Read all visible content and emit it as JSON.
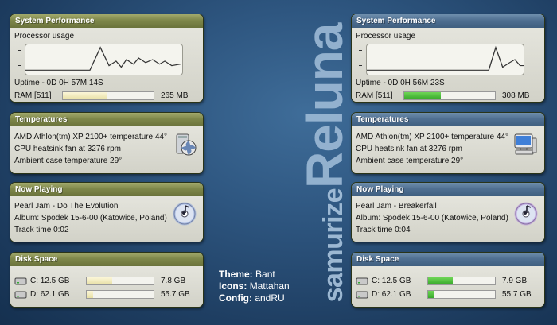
{
  "brand": {
    "word1": "samurize",
    "word2": "Reluna"
  },
  "credits": {
    "theme_label": "Theme:",
    "theme_value": "Bant",
    "icons_label": "Icons:",
    "icons_value": "Mattahan",
    "config_label": "Config:",
    "config_value": "andRU"
  },
  "left": {
    "perf": {
      "title": "System Performance",
      "proc_label": "Processor usage",
      "uptime": "Uptime -  0D 0H 57M 14S",
      "ram_label": "RAM [511]",
      "ram_value": "265 MB",
      "ram_fraction": 0.48
    },
    "temps": {
      "title": "Temperatures",
      "line1": "AMD Athlon(tm) XP 2100+ temperature 44°",
      "line2": "CPU heatsink fan at 3276 rpm",
      "line3": "Ambient case temperature 29°"
    },
    "now": {
      "title": "Now Playing",
      "line1": "Pearl Jam - Do The Evolution",
      "line2": "Album: Spodek 15-6-00 (Katowice, Poland)",
      "line3": "Track time 0:02"
    },
    "disk": {
      "title": "Disk Space",
      "c_label": "C: 12.5 GB",
      "c_value": "7.8 GB",
      "c_fraction": 0.38,
      "d_label": "D: 62.1 GB",
      "d_value": "55.7 GB",
      "d_fraction": 0.1
    }
  },
  "right": {
    "perf": {
      "title": "System Performance",
      "proc_label": "Processor usage",
      "uptime": "Uptime -  0D 0H 56M 23S",
      "ram_label": "RAM [511]",
      "ram_value": "308 MB",
      "ram_fraction": 0.4
    },
    "temps": {
      "title": "Temperatures",
      "line1": "AMD Athlon(tm) XP 2100+ temperature 44°",
      "line2": "CPU heatsink fan at 3276 rpm",
      "line3": "Ambient case temperature 29°"
    },
    "now": {
      "title": "Now Playing",
      "line1": "Pearl Jam - Breakerfall",
      "line2": "Album: Spodek 15-6-00 (Katowice, Poland)",
      "line3": "Track time 0:04"
    },
    "disk": {
      "title": "Disk Space",
      "c_label": "C: 12.5 GB",
      "c_value": "7.9 GB",
      "c_fraction": 0.37,
      "d_label": "D: 62.1 GB",
      "d_value": "55.7 GB",
      "d_fraction": 0.1
    }
  },
  "icons": {
    "temps_left": "cpu-fan-icon",
    "temps_right": "computer-icon",
    "now_playing": "cd-music-icon",
    "drive": "hard-drive-icon"
  },
  "colors": {
    "olive_header": "#7e874a",
    "blue_header": "#4f6f91",
    "bar_cream": "#ece4ad",
    "bar_green": "#3fb22f"
  }
}
